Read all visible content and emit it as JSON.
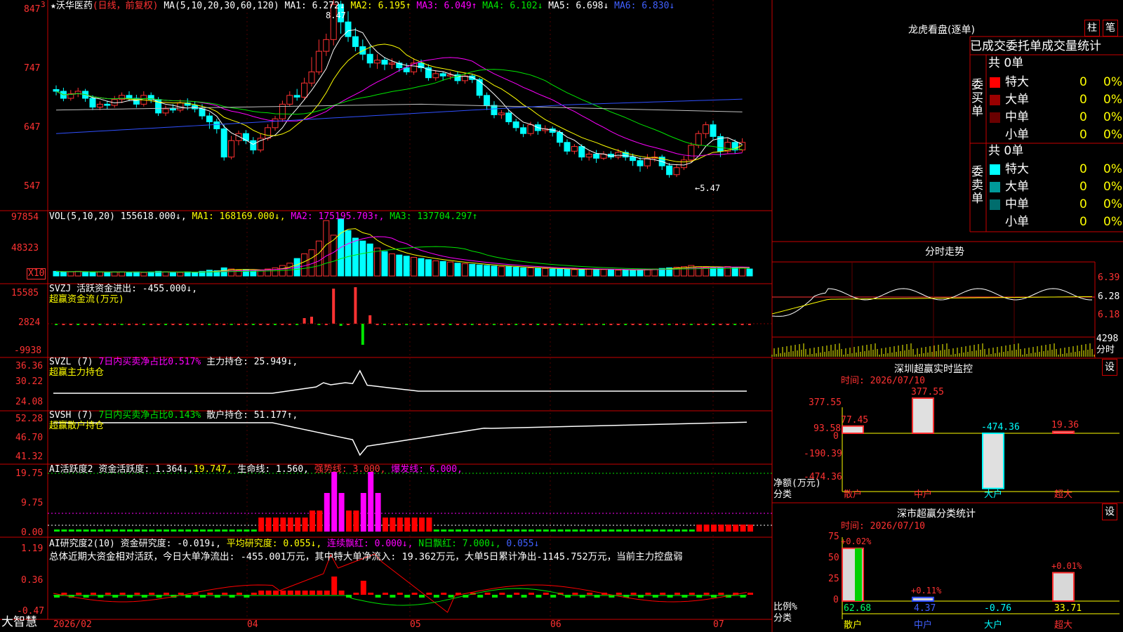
{
  "header": {
    "star": "★",
    "stock_name": "沃华医药",
    "period": "(日线，前复权)",
    "ma_label": "MA(5,10,20,30,60,120)",
    "ma1": "MA1: 6.272↓",
    "ma2": "MA2: 6.195↑",
    "ma3": "MA3: 6.049↑",
    "ma4": "MA4: 6.102↓",
    "ma5": "MA5: 6.698↓",
    "ma6": "MA6: 6.830↓",
    "high_note": "8.47",
    "low_note": "←5.47"
  },
  "axes": {
    "price_ticks": [
      "847",
      "747",
      "647",
      "547"
    ],
    "vol_ticks": [
      "97854",
      "48323"
    ],
    "vol_unit": "X10",
    "svzj_ticks": [
      "15585",
      "2824",
      "-9938"
    ],
    "svzl_ticks": [
      "36.36",
      "30.22",
      "24.08"
    ],
    "svsh_ticks": [
      "52.28",
      "46.70",
      "41.32"
    ],
    "ai_ticks": [
      "19.75",
      "9.75",
      "0.00"
    ],
    "res_ticks": [
      "1.19",
      "0.36",
      "-0.47"
    ],
    "date_ticks": [
      "2026/02",
      "04",
      "05",
      "06",
      "07"
    ],
    "corner_mark": "3"
  },
  "panels": {
    "vol": {
      "name": "VOL(5,10,20)",
      "value": "155618.000↓,",
      "ma1": "MA1: 168169.000↓,",
      "ma2": "MA2: 175195.703↑,",
      "ma3": "MA3: 137704.297↑"
    },
    "svzj": {
      "name": "SVZJ",
      "label": "活跃资金进出: -455.000↓,",
      "sub": "超赢资金流(万元)"
    },
    "svzl": {
      "name": "SVZL (7)",
      "ratio": "7日内买卖净占比0.517%",
      "hold": "主力持仓: 25.949↓,",
      "sub": "超赢主力持仓"
    },
    "svsh": {
      "name": "SVSH (7)",
      "ratio": "7日内买卖净占比0.143%",
      "hold": "散户持仓: 51.177↑,",
      "sub": "超赢散户持仓"
    },
    "ai": {
      "name": "AI活跃度2",
      "v1": "资金活跃度: 1.364↓,",
      "v2": "19.747,",
      "v3": "生命线: 1.560,",
      "v4": "强势线: 3.000,",
      "v5": "爆发线: 6.000,"
    },
    "res": {
      "name": "AI研究度2(10)",
      "v1": "资金研究度: -0.019↓,",
      "v2": "平均研究度: 0.055↓,",
      "v3": "连续飘红: 0.000↓,",
      "v4": "N日飘红: 7.000↓,",
      "v5": "0.055↓",
      "summary": "总体近期大资金相对活跃，今日大单净流出: -455.001万元，其中特大单净流入: 19.362万元，大单5日累计净出-1145.752万元，当前主力控盘弱"
    }
  },
  "brand": "大智慧",
  "right": {
    "dragon": {
      "title": "龙虎看盘(逐单)",
      "btn_bar": "柱",
      "btn_pen": "笔",
      "tab_text": "已成交委托单成交量统计",
      "buy_label": "委买单",
      "sell_label": "委卖单",
      "buy_total": "共 0单",
      "sell_total": "共 0单",
      "buy_rows": [
        {
          "name": "特大",
          "count": "0",
          "pct": "0%",
          "color": "#ff0000"
        },
        {
          "name": "大单",
          "count": "0",
          "pct": "0%",
          "color": "#9a0000"
        },
        {
          "name": "中单",
          "count": "0",
          "pct": "0%",
          "color": "#6a0000"
        },
        {
          "name": "小单",
          "count": "0",
          "pct": "0%",
          "color": ""
        }
      ],
      "sell_rows": [
        {
          "name": "特大",
          "count": "0",
          "pct": "0%",
          "color": "#00ffff"
        },
        {
          "name": "大单",
          "count": "0",
          "pct": "0%",
          "color": "#009999"
        },
        {
          "name": "中单",
          "count": "0",
          "pct": "0%",
          "color": "#006d6d"
        },
        {
          "name": "小单",
          "count": "0",
          "pct": "0%",
          "color": ""
        }
      ]
    },
    "intraday": {
      "title": "分时走势",
      "ticks": [
        "6.39",
        "6.28",
        "6.18"
      ],
      "vol_tick": "4298",
      "vol_unit": "分时"
    },
    "monitor": {
      "title": "深圳超赢实时监控",
      "btn": "设",
      "time": "时间: 2026/07/10",
      "ticks": [
        "377.55",
        "93.58",
        "0",
        "-190.39",
        "-474.36"
      ],
      "ylabel": "净额(万元)",
      "xlabel": "分类",
      "categories": [
        "散户",
        "中户",
        "大户",
        "超大"
      ],
      "values": [
        77.45,
        377.55,
        -474.36,
        19.36
      ],
      "value_labels": [
        "77.45",
        "377.55",
        "-474.36",
        "19.36"
      ]
    },
    "classify": {
      "title": "深市超赢分类统计",
      "btn": "设",
      "time": "时间: 2026/07/10",
      "ticks": [
        "75",
        "50",
        "25",
        "0"
      ],
      "ylabel": "比例%",
      "xlabel": "分类",
      "categories": [
        "散户",
        "中户",
        "大户",
        "超大"
      ],
      "bar_labels": [
        "+0.02%",
        "+0.11%",
        "",
        "+0.01%"
      ],
      "bottom_values": [
        "62.68",
        "4.37",
        "-0.76",
        "33.71"
      ],
      "bar_values": [
        62.68,
        4.37,
        0,
        33.71
      ]
    }
  },
  "chart_data": [
    {
      "type": "candlestick",
      "title": "沃华医药 (日线，前复权)",
      "ylim": [
        500,
        860
      ],
      "yticks": [
        847,
        747,
        647,
        547
      ],
      "x_dates": [
        "2026/02",
        "04",
        "05",
        "06",
        "07"
      ],
      "candles": [
        [
          715,
          712,
          722,
          705
        ],
        [
          712,
          700,
          718,
          695
        ],
        [
          700,
          708,
          714,
          696
        ],
        [
          708,
          712,
          718,
          702
        ],
        [
          712,
          700,
          716,
          694
        ],
        [
          700,
          685,
          705,
          680
        ],
        [
          685,
          690,
          695,
          680
        ],
        [
          690,
          688,
          696,
          682
        ],
        [
          688,
          698,
          704,
          684
        ],
        [
          698,
          705,
          710,
          692
        ],
        [
          705,
          700,
          712,
          695
        ],
        [
          700,
          690,
          706,
          684
        ],
        [
          690,
          705,
          712,
          686
        ],
        [
          705,
          698,
          710,
          692
        ],
        [
          698,
          675,
          702,
          670
        ],
        [
          675,
          682,
          688,
          670
        ],
        [
          682,
          680,
          690,
          675
        ],
        [
          680,
          692,
          698,
          676
        ],
        [
          692,
          688,
          700,
          680
        ],
        [
          688,
          682,
          694,
          676
        ],
        [
          682,
          670,
          690,
          664
        ],
        [
          670,
          660,
          676,
          648
        ],
        [
          660,
          648,
          665,
          640
        ],
        [
          648,
          600,
          655,
          594
        ],
        [
          600,
          628,
          636,
          596
        ],
        [
          628,
          640,
          645,
          620
        ],
        [
          640,
          628,
          646,
          622
        ],
        [
          628,
          612,
          634,
          605
        ],
        [
          612,
          632,
          640,
          608
        ],
        [
          632,
          650,
          656,
          628
        ],
        [
          650,
          665,
          670,
          645
        ],
        [
          665,
          690,
          696,
          660
        ],
        [
          690,
          705,
          712,
          686
        ],
        [
          705,
          702,
          716,
          696
        ],
        [
          702,
          726,
          735,
          698
        ],
        [
          726,
          745,
          770,
          720
        ],
        [
          745,
          780,
          800,
          740
        ],
        [
          780,
          800,
          810,
          772
        ],
        [
          800,
          860,
          870,
          790
        ],
        [
          860,
          830,
          866,
          810
        ],
        [
          830,
          805,
          848,
          796
        ],
        [
          805,
          788,
          820,
          780
        ],
        [
          788,
          775,
          800,
          765
        ],
        [
          775,
          760,
          790,
          752
        ],
        [
          760,
          765,
          775,
          750
        ],
        [
          765,
          758,
          770,
          748
        ],
        [
          758,
          760,
          768,
          750
        ],
        [
          760,
          752,
          764,
          745
        ],
        [
          752,
          745,
          760,
          740
        ],
        [
          745,
          760,
          768,
          740
        ],
        [
          760,
          752,
          766,
          745
        ],
        [
          752,
          735,
          758,
          730
        ],
        [
          735,
          742,
          748,
          730
        ],
        [
          742,
          738,
          746,
          730
        ],
        [
          738,
          740,
          745,
          732
        ],
        [
          740,
          730,
          746,
          724
        ],
        [
          730,
          738,
          744,
          725
        ],
        [
          738,
          732,
          742,
          726
        ],
        [
          732,
          705,
          735,
          700
        ],
        [
          705,
          688,
          710,
          680
        ],
        [
          688,
          672,
          695,
          666
        ],
        [
          672,
          675,
          680,
          665
        ],
        [
          675,
          660,
          680,
          655
        ],
        [
          660,
          650,
          665,
          644
        ],
        [
          650,
          640,
          656,
          634
        ],
        [
          640,
          655,
          660,
          636
        ],
        [
          655,
          645,
          660,
          638
        ],
        [
          645,
          648,
          654,
          640
        ],
        [
          648,
          642,
          652,
          635
        ],
        [
          642,
          625,
          646,
          618
        ],
        [
          625,
          610,
          630,
          604
        ],
        [
          610,
          618,
          622,
          605
        ],
        [
          618,
          600,
          622,
          594
        ],
        [
          600,
          605,
          610,
          594
        ],
        [
          605,
          598,
          612,
          590
        ],
        [
          598,
          605,
          610,
          595
        ],
        [
          605,
          600,
          610,
          596
        ],
        [
          600,
          608,
          614,
          596
        ],
        [
          608,
          600,
          612,
          594
        ],
        [
          600,
          594,
          606,
          585
        ],
        [
          594,
          585,
          600,
          575
        ],
        [
          585,
          598,
          605,
          580
        ],
        [
          598,
          600,
          610,
          592
        ],
        [
          600,
          585,
          604,
          578
        ],
        [
          585,
          570,
          590,
          565
        ],
        [
          570,
          582,
          588,
          566
        ],
        [
          582,
          595,
          602,
          578
        ],
        [
          595,
          620,
          625,
          590
        ],
        [
          620,
          640,
          645,
          615
        ],
        [
          640,
          655,
          660,
          632
        ],
        [
          655,
          635,
          662,
          630
        ],
        [
          635,
          610,
          640,
          600
        ],
        [
          610,
          625,
          632,
          605
        ],
        [
          625,
          612,
          630,
          606
        ],
        [
          612,
          625,
          632,
          608
        ]
      ],
      "ma_lines_note": "MA1..MA6 overlay"
    },
    {
      "type": "bar",
      "title": "VOL(5,10,20)",
      "ylim": [
        0,
        100000
      ],
      "yticks": [
        97854,
        48323
      ],
      "values": [
        8,
        7,
        7,
        8,
        7,
        6,
        7,
        6,
        7,
        7,
        6,
        7,
        6,
        7,
        8,
        7,
        6,
        6,
        7,
        6,
        8,
        10,
        9,
        14,
        12,
        10,
        11,
        9,
        10,
        12,
        14,
        18,
        22,
        30,
        38,
        45,
        60,
        95,
        70,
        98,
        78,
        65,
        60,
        55,
        48,
        42,
        38,
        36,
        34,
        32,
        30,
        28,
        26,
        25,
        24,
        22,
        21,
        20,
        19,
        18,
        17,
        16,
        16,
        15,
        14,
        14,
        13,
        13,
        12,
        12,
        12,
        11,
        11,
        12,
        12,
        11,
        11,
        10,
        10,
        10,
        11,
        12,
        12,
        13,
        14,
        15,
        16,
        18,
        16,
        15,
        14,
        15,
        16,
        15,
        14,
        12
      ]
    },
    {
      "type": "bar",
      "title": "SVZJ 活跃资金进出",
      "ylim": [
        -9938,
        15585
      ],
      "yticks": [
        15585,
        2824,
        -9938
      ]
    }
  ]
}
